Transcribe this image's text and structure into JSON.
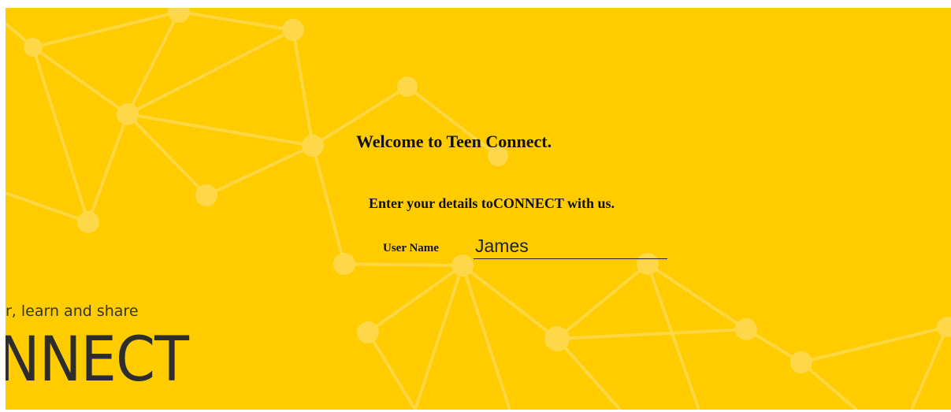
{
  "colors": {
    "background": "#FFCC00",
    "network": "#FFE36B",
    "text": "#111111",
    "logo": "#2d2d2d"
  },
  "page": {
    "welcome_title": "Welcome to Teen Connect.",
    "subtitle": "Enter your details toCONNECT with us.",
    "username_label": "User Name",
    "username_value": "James"
  },
  "brand": {
    "tagline_fragment": "r, learn and share",
    "logo_fragment": "NNECT"
  }
}
